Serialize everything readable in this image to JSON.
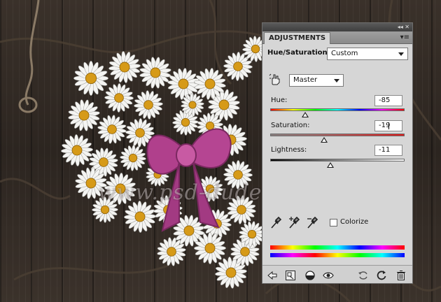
{
  "panel": {
    "tab_label": "ADJUSTMENTS",
    "title": "Hue/Saturation",
    "preset_value": "Custom",
    "channel_value": "Master"
  },
  "hue": {
    "label": "Hue:",
    "value": "-85",
    "slider_fraction": 0.26
  },
  "saturation": {
    "label": "Saturation:",
    "value": "-19",
    "slider_fraction": 0.4
  },
  "lightness": {
    "label": "Lightness:",
    "value": "-11",
    "slider_fraction": 0.45
  },
  "colorize": {
    "label": "Colorize",
    "checked": false
  },
  "watermark": {
    "text": "www.psd-dude.com"
  },
  "icons": {
    "strip": [
      "minimize-icon",
      "close-icon"
    ],
    "panel_menu": "panel-menu-icon",
    "targeted_adjustment": "hand-adjust-icon",
    "eyedroppers": [
      "eyedropper-icon",
      "eyedropper-plus-icon",
      "eyedropper-minus-icon"
    ],
    "footer": [
      "back-arrow-icon",
      "clip-to-layer-icon",
      "visibility-circle-icon",
      "eye-icon",
      "view-previous-icon",
      "reset-icon",
      "trash-icon"
    ]
  },
  "colors": {
    "panel_bg": "#d6d6d6",
    "bow": "#b0408c",
    "daisy_petal": "#f4f4f2",
    "daisy_center": "#d69a18"
  }
}
